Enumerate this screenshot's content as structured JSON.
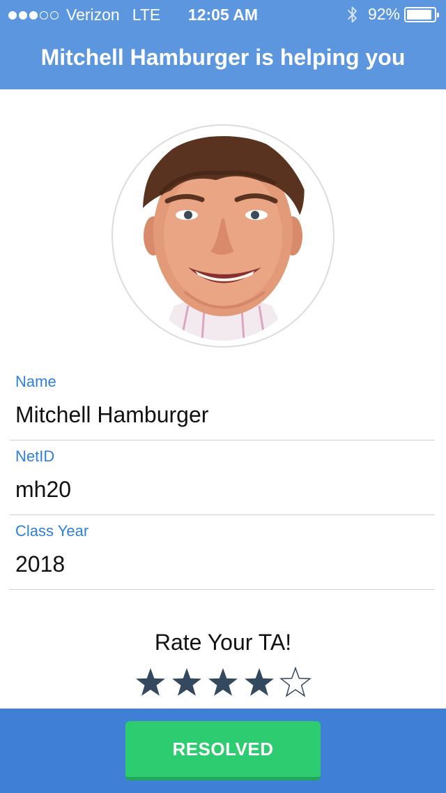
{
  "status_bar": {
    "carrier": "Verizon",
    "network": "LTE",
    "time": "12:05 AM",
    "battery_percent": "92%",
    "battery_level": 0.92,
    "signal_bars_filled": 3,
    "signal_bars_total": 5
  },
  "header": {
    "title": "Mitchell Hamburger is helping you",
    "background_color": "#5b96df"
  },
  "profile": {
    "photo": "ta-profile-photo",
    "fields": [
      {
        "label": "Name",
        "value": "Mitchell Hamburger"
      },
      {
        "label": "NetID",
        "value": "mh20"
      },
      {
        "label": "Class Year",
        "value": "2018"
      }
    ]
  },
  "rating": {
    "title": "Rate Your TA!",
    "value": 4,
    "max": 5,
    "filled_color": "#34495e"
  },
  "footer": {
    "button_label": "RESOLVED",
    "button_color": "#2ecc71",
    "bar_color": "#3f7fd6"
  }
}
